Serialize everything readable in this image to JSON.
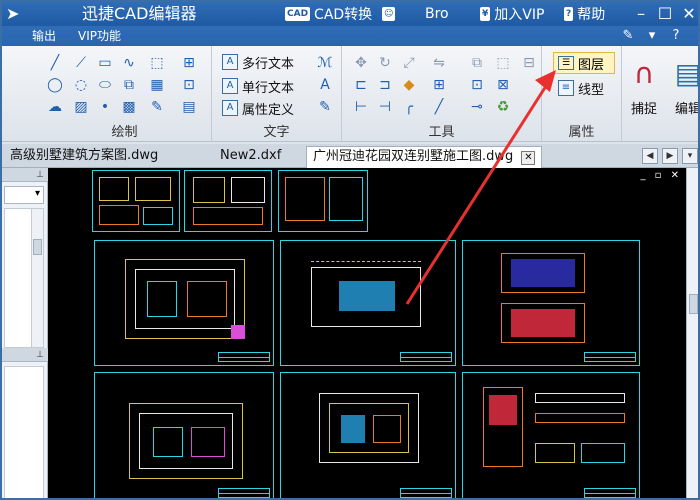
{
  "titlebar": {
    "app_title": "迅捷CAD编辑器",
    "cad_convert": "CAD转换",
    "bro": "Bro",
    "vip": "加入VIP",
    "help": "帮助"
  },
  "menubar": {
    "items": [
      "输出",
      "VIP功能"
    ]
  },
  "ribbon": {
    "groups": {
      "draw": "绘制",
      "text": "文字",
      "tools": "工具",
      "props": "属性"
    },
    "text_items": [
      "多行文本",
      "单行文本",
      "属性定义"
    ],
    "props_items": [
      "图层",
      "线型"
    ],
    "big_buttons": [
      "捕捉",
      "编辑"
    ]
  },
  "doc_tabs": [
    {
      "label": "高级别墅建筑方案图.dwg",
      "active": false
    },
    {
      "label": "New2.dxf",
      "active": false
    },
    {
      "label": "广州冠迪花园双连别墅施工图.dwg",
      "active": true
    }
  ],
  "colors": {
    "titlebar": "#2f6db6",
    "canvas_bg": "#000000",
    "sheet_border": "#2ed3e6",
    "arrow": "#e8312f",
    "highlight": "#fff4c2"
  },
  "icons": {
    "app": "app-arrow-icon",
    "close_tab": "close-icon"
  }
}
